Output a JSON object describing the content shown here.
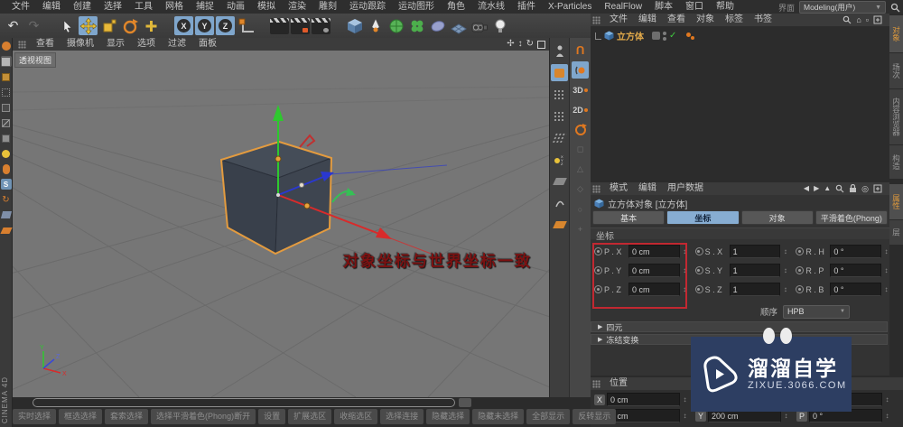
{
  "menubar": {
    "items": [
      "文件",
      "编辑",
      "创建",
      "选择",
      "工具",
      "网格",
      "捕捉",
      "动画",
      "模拟",
      "渲染",
      "雕刻",
      "运动跟踪",
      "运动图形",
      "角色",
      "流水线",
      "插件",
      "X-Particles",
      "RealFlow",
      "脚本",
      "窗口",
      "帮助"
    ],
    "interface_label": "界面",
    "layout_preset": "Modeling(用户)"
  },
  "toolbar": {
    "icons": [
      "undo",
      "redo",
      "select-arrow",
      "move-tool",
      "scale-tool",
      "rotate-tool",
      "last-tool",
      "lock-x",
      "lock-y",
      "lock-z",
      "coordinate-system",
      "render-view",
      "render-picture-viewer",
      "render-settings",
      "primitive-cube",
      "pen-spline",
      "subdivision-surface",
      "mograph",
      "deformer",
      "floor",
      "camera",
      "light"
    ],
    "axis_letters": [
      "X",
      "Y",
      "Z"
    ]
  },
  "left_toolbar": {
    "brand": "CINEMA 4D"
  },
  "viewport": {
    "menu": [
      "查看",
      "摄像机",
      "显示",
      "选项",
      "过滤",
      "面板"
    ],
    "label": "透视视图",
    "annotation": "对象坐标与世界坐标一致"
  },
  "object_manager": {
    "menu": [
      "文件",
      "编辑",
      "查看",
      "对象",
      "标签",
      "书签"
    ],
    "object_name": "立方体"
  },
  "panel_tabs": {
    "top": [
      "对象",
      "场次",
      "内容浏览器",
      "构造"
    ],
    "bottom": [
      "属性",
      "层"
    ]
  },
  "attribute_manager": {
    "menu": [
      "模式",
      "编辑",
      "用户数据"
    ],
    "title": "立方体对象 [立方体]",
    "tabs": [
      "基本",
      "坐标",
      "对象",
      "平滑着色(Phong)"
    ],
    "active_tab": "坐标",
    "section": "坐标",
    "coord_rows": [
      {
        "p": "P . X",
        "pv": "0 cm",
        "s": "S . X",
        "sv": "1",
        "r": "R . H",
        "rv": "0 °"
      },
      {
        "p": "P . Y",
        "pv": "0 cm",
        "s": "S . Y",
        "sv": "1",
        "r": "R . P",
        "rv": "0 °"
      },
      {
        "p": "P . Z",
        "pv": "0 cm",
        "s": "S . Z",
        "sv": "1",
        "r": "R . B",
        "rv": "0 °"
      }
    ],
    "order_label": "顺序",
    "order_value": "HPB",
    "collapsed_sections": [
      "四元",
      "冻结变换"
    ]
  },
  "coordinate_manager": {
    "header": "位置",
    "rows": [
      {
        "c1l": "X",
        "c1v": "0 cm",
        "c2l": "",
        "c2v": "",
        "c3l": "",
        "c3v": ""
      },
      {
        "c1l": "Y",
        "c1v": "0 cm",
        "c2l": "Y",
        "c2v": "200 cm",
        "c3l": "P",
        "c3v": "0 °"
      }
    ]
  },
  "watermark": {
    "title": "溜溜自学",
    "url": "zixue.3066.com"
  },
  "bottom_tabs": [
    "实时选择",
    "框选选择",
    "套索选择",
    "选择平滑着色(Phong)断开",
    "设置",
    "扩展选区",
    "收缩选区",
    "选择连接",
    "隐藏选择",
    "隐藏未选择",
    "全部显示",
    "反转显示"
  ],
  "colors": {
    "accent_blue": "#87add2",
    "selection_orange": "#e0a23c",
    "axis_x": "#d82b2b",
    "axis_y": "#2ec82e",
    "axis_z": "#2a38d0",
    "highlight_red": "#c22831",
    "watermark_bg": "#2d3e62"
  }
}
